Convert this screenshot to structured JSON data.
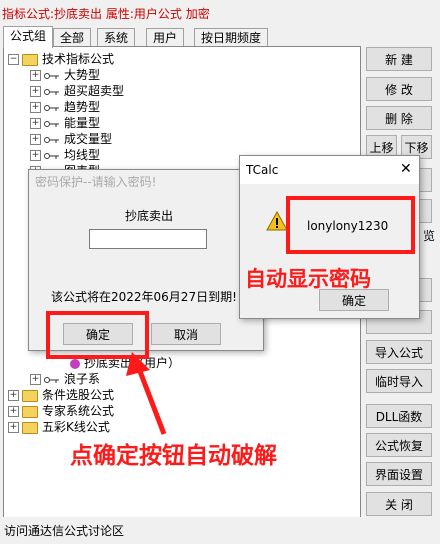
{
  "window": {
    "title": "指标公式:抄底卖出 属性:用户公式 加密"
  },
  "tabs": [
    "公式组",
    "全部",
    "系统",
    "用户",
    "按日期频度"
  ],
  "tree": {
    "root": "技术指标公式",
    "children": [
      "大势型",
      "超买超卖型",
      "趋势型",
      "能量型",
      "成交量型",
      "均线型",
      "图表型"
    ],
    "visible_sub": [
      "浪子系"
    ],
    "partial_items": [
      "抄底卖出（用户）"
    ],
    "others": [
      "条件选股公式",
      "专家系统公式",
      "五彩K线公式"
    ]
  },
  "right_buttons": {
    "new": "新 建",
    "modify": "修 改",
    "delete": "删 除",
    "up": "上移",
    "down": "下移",
    "import": "导入公式",
    "temp_import": "临时导入",
    "dll": "DLL函数",
    "restore": "公式恢复",
    "ui_settings": "界面设置",
    "close": "关 闭",
    "partial_label": "览"
  },
  "status": {
    "text": "访问通达信公式讨论区"
  },
  "password_dialog": {
    "title": "密码保护--请输入密码!",
    "formula_name": "抄底卖出",
    "password_value": "",
    "expire_text": "该公式将在2022年06月27日到期!",
    "ok": "确定",
    "cancel": "取消"
  },
  "tcalc_dialog": {
    "title": "TCalc",
    "close_glyph": "✕",
    "message": "lonylony1230",
    "ok": "确定"
  },
  "annotations": {
    "auto_show": "自动显示密码",
    "click_ok": "点确定按钮自动破解"
  },
  "colors": {
    "annotation": "#ff1a1a",
    "title_red": "#d00000"
  }
}
